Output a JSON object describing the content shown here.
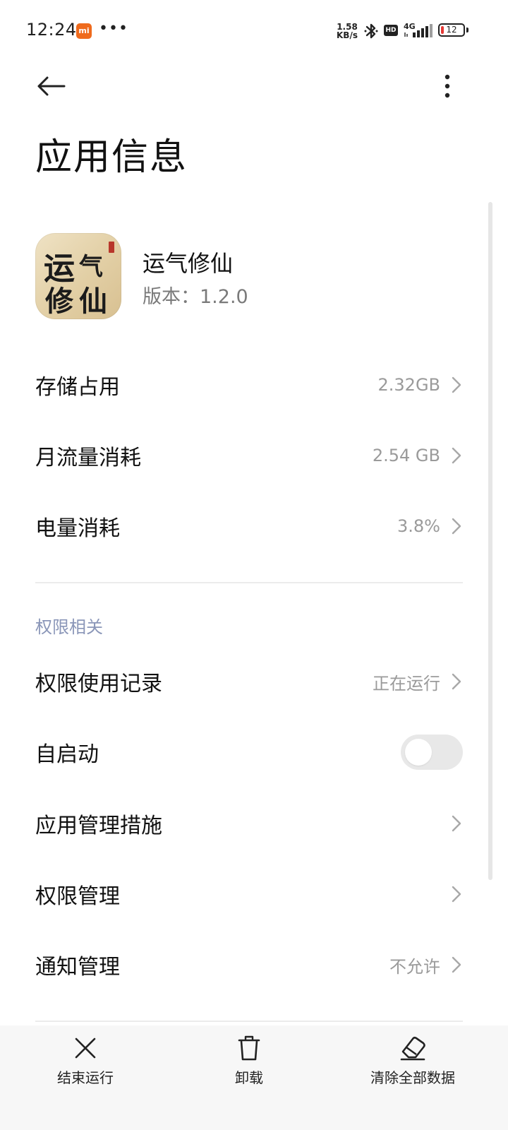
{
  "status_bar": {
    "time": "12:24",
    "mi_badge": "mi",
    "notification_dots": "•••",
    "net_speed_value": "1.58",
    "net_speed_unit": "KB/s",
    "hd_badge": "HD",
    "network_type": "4G",
    "battery_level": "12",
    "battery_fraction": 0.12
  },
  "header": {
    "title": "应用信息"
  },
  "app": {
    "name": "运气修仙",
    "version": "版本：1.2.0",
    "icon_text": [
      "运",
      "气",
      "修",
      "仙"
    ]
  },
  "usage_rows": [
    {
      "label": "存储占用",
      "value": "2.32GB"
    },
    {
      "label": "月流量消耗",
      "value": "2.54 GB"
    },
    {
      "label": "电量消耗",
      "value": "3.8%"
    }
  ],
  "permissions": {
    "section_title": "权限相关",
    "rows": [
      {
        "label": "权限使用记录",
        "value": "正在运行"
      },
      {
        "label": "自启动",
        "toggle_on": false
      },
      {
        "label": "应用管理措施",
        "value": ""
      },
      {
        "label": "权限管理",
        "value": ""
      },
      {
        "label": "通知管理",
        "value": "不允许"
      }
    ]
  },
  "bottom_actions": [
    {
      "label": "结束运行",
      "icon": "close-icon"
    },
    {
      "label": "卸载",
      "icon": "trash-icon"
    },
    {
      "label": "清除全部数据",
      "icon": "eraser-icon"
    }
  ],
  "colors": {
    "section_title": "#8a96b8",
    "secondary_text": "#9a9a9a",
    "battery_low": "#e53935",
    "mi_badge": "#ef6a1c"
  }
}
